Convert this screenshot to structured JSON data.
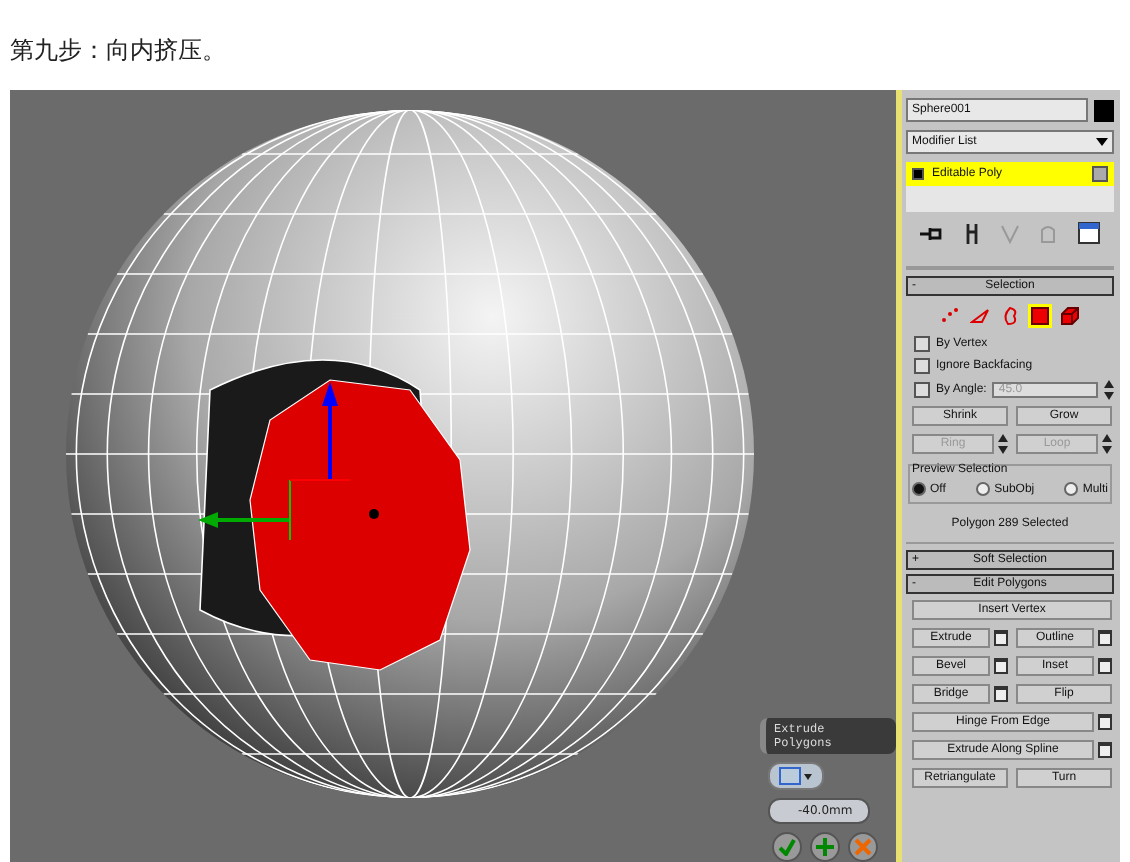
{
  "caption": "第九步：向内挤压。",
  "caddy": {
    "title": "Extrude Polygons",
    "value": "-40.0mm"
  },
  "panel": {
    "object_name": "Sphere001",
    "modifier_list": "Modifier List",
    "stack": [
      {
        "label": "Editable Poly",
        "selected": true
      }
    ],
    "selection": {
      "sign": "-",
      "title": "Selection",
      "subobjects": [
        {
          "kind": "vertex",
          "selected": false
        },
        {
          "kind": "edge",
          "selected": false
        },
        {
          "kind": "border",
          "selected": false
        },
        {
          "kind": "polygon",
          "selected": true
        },
        {
          "kind": "element",
          "selected": false
        }
      ],
      "checks": [
        {
          "label": "By Vertex",
          "checked": false
        },
        {
          "label": "Ignore Backfacing",
          "checked": false
        }
      ],
      "by_angle": {
        "label": "By Angle:",
        "checked": false,
        "value": "45.0"
      },
      "buttons": [
        [
          {
            "label": "Shrink",
            "disabled": false,
            "spinner": false
          },
          {
            "label": "Grow",
            "disabled": false,
            "spinner": false
          }
        ],
        [
          {
            "label": "Ring",
            "disabled": true,
            "spinner": true
          },
          {
            "label": "Loop",
            "disabled": true,
            "spinner": true
          }
        ]
      ],
      "preview": {
        "title": "Preview Selection",
        "options": [
          {
            "label": "Off",
            "selected": true
          },
          {
            "label": "SubObj",
            "selected": false
          },
          {
            "label": "Multi",
            "selected": false
          }
        ]
      },
      "status": "Polygon 289 Selected"
    },
    "rollouts": [
      {
        "sign": "+",
        "title": "Soft Selection"
      },
      {
        "sign": "-",
        "title": "Edit Polygons"
      }
    ],
    "edit_polygons": [
      [
        {
          "label": "Insert Vertex",
          "settings": false
        }
      ],
      [
        {
          "label": "Extrude",
          "settings": true
        },
        {
          "label": "Outline",
          "settings": true
        }
      ],
      [
        {
          "label": "Bevel",
          "settings": true
        },
        {
          "label": "Inset",
          "settings": true
        }
      ],
      [
        {
          "label": "Bridge",
          "settings": true
        },
        {
          "label": "Flip",
          "settings": false
        }
      ],
      [
        {
          "label": "Hinge From Edge",
          "settings": true
        }
      ],
      [
        {
          "label": "Extrude Along Spline",
          "settings": true
        }
      ],
      [
        {
          "label": "Retriangulate",
          "settings": false
        },
        {
          "label": "Turn",
          "settings": false
        }
      ]
    ]
  }
}
